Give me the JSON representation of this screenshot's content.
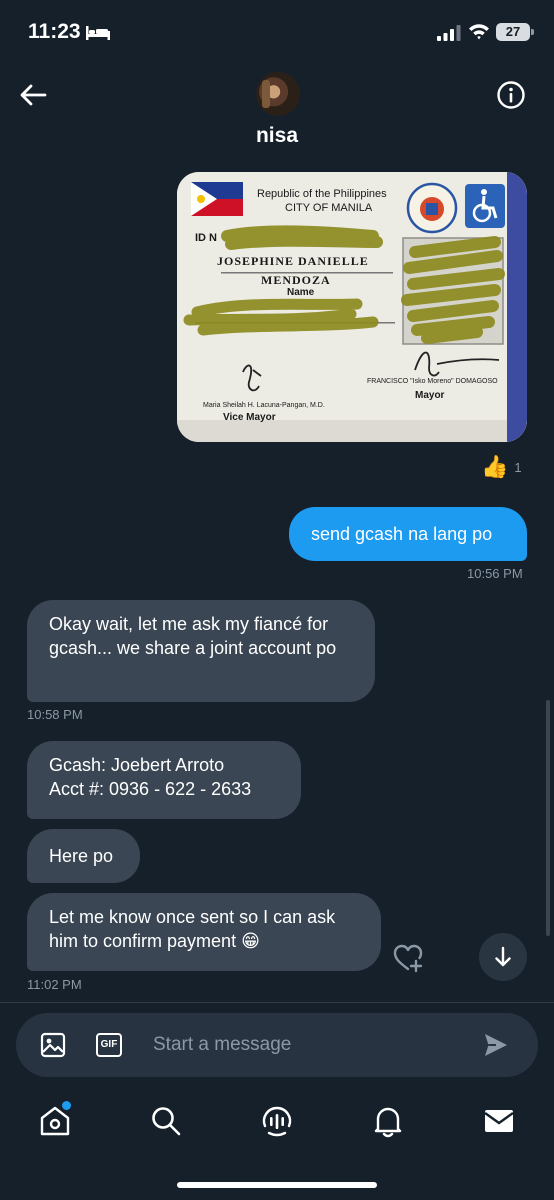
{
  "status_bar": {
    "time": "11:23",
    "battery": "27"
  },
  "header": {
    "contact_name": "nisa"
  },
  "image_message": {
    "card_lines": {
      "country": "Republic of the Philippines",
      "city": "CITY OF MANILA",
      "id_prefix": "ID N",
      "name_line1": "JOSEPHINE DANIELLE",
      "name_line2": "MENDOZA",
      "name_label": "Name",
      "vice_mayor_name": "Maria Sheilah H. Lacuna-Pangan, M.D.",
      "vice_mayor_title": "Vice Mayor",
      "mayor_name": "FRANCISCO \"Isko Moreno\" DOMAGOSO",
      "mayor_title": "Mayor"
    },
    "reaction_emoji": "👍",
    "reaction_count": "1"
  },
  "messages": [
    {
      "id": "m1",
      "direction": "sent",
      "text": "send gcash na lang po",
      "time": "10:56 PM"
    },
    {
      "id": "m2",
      "direction": "received",
      "text": "Okay wait, let me ask my fiancé for gcash... we share a joint account po",
      "time": "10:58 PM"
    },
    {
      "id": "m3",
      "direction": "received",
      "line1": "Gcash: Joebert Arroto",
      "line2": "Acct #: 0936 - 622 - 2633"
    },
    {
      "id": "m4",
      "direction": "received",
      "text": "Here po"
    },
    {
      "id": "m5",
      "direction": "received",
      "text": "Let me know once sent so I can ask him to confirm payment 😁",
      "time": "11:02 PM"
    }
  ],
  "composer": {
    "placeholder": "Start a message",
    "gif_label": "GIF"
  },
  "colors": {
    "background": "#15202b",
    "sent_bubble": "#1d9bf0",
    "received_bubble": "#3a4653",
    "accent": "#1d9bf0"
  }
}
